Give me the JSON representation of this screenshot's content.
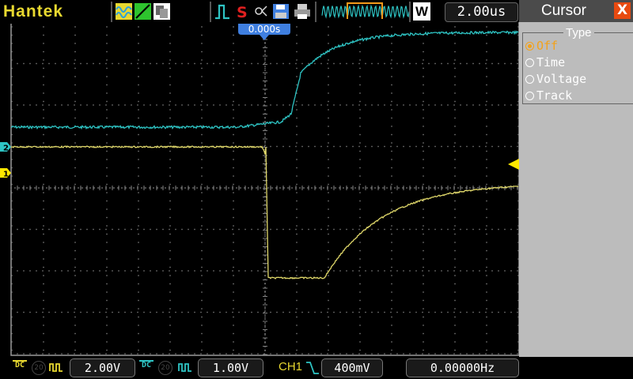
{
  "app": {
    "brand": "Hantek"
  },
  "toolbar": {
    "timebase_label": "W",
    "timebase": "2.00us",
    "icons": [
      "waveform-icon",
      "line-mode-icon",
      "persistence-icon",
      "trigger-edge-icon",
      "stop-icon",
      "save-icon",
      "print-icon",
      "memory-map-icon"
    ]
  },
  "scope": {
    "trigger_time": "0.000s",
    "ch2_marker": "2",
    "ch1_marker": "1",
    "colors": {
      "ch1": "#e0d86a",
      "ch2": "#2ec4c4",
      "grid": "#808080",
      "trigger_tag": "#3f7fe0",
      "trigger_level": "#ffe800"
    }
  },
  "panel": {
    "title": "Cursor",
    "close": "X",
    "group_label": "Type",
    "options": [
      {
        "label": "Off",
        "selected": true
      },
      {
        "label": "Time",
        "selected": false
      },
      {
        "label": "Voltage",
        "selected": false
      },
      {
        "label": "Track",
        "selected": false
      }
    ]
  },
  "status": {
    "ch1_coupling": "DC",
    "ch1_bw": "20",
    "ch1_scale": "2.00V",
    "ch2_coupling": "DC",
    "ch2_bw": "20",
    "ch2_scale": "1.00V",
    "trigger_source": "CH1",
    "trigger_level": "400mV",
    "frequency": "0.00000Hz"
  }
}
